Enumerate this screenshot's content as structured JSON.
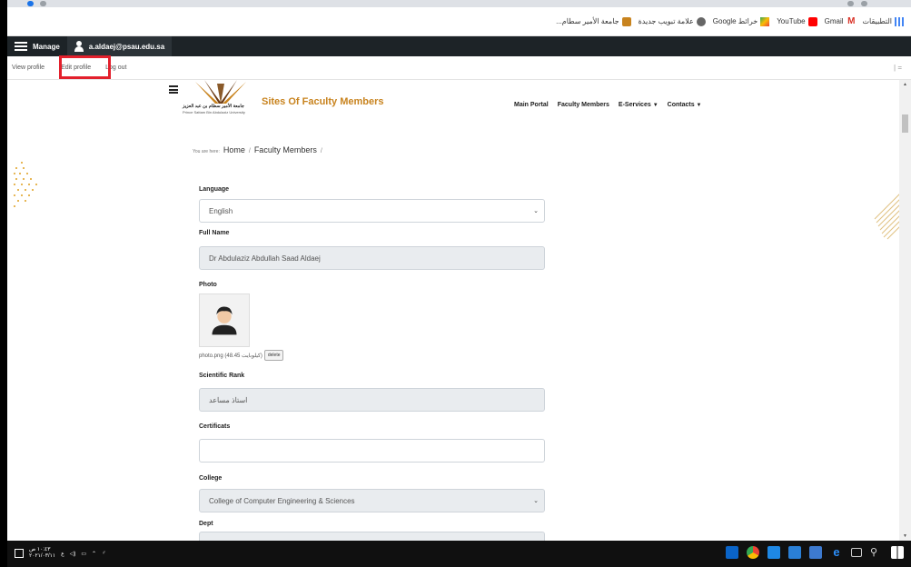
{
  "bookmarks": {
    "apps_label": "التطبيقات",
    "items": [
      "Gmail",
      "YouTube",
      "خرائط Google",
      "علامة تبويب جديدة",
      "جامعة الأمير سطام..."
    ]
  },
  "adminbar": {
    "manage_label": "Manage",
    "user_email": "a.aldaej@psau.edu.sa"
  },
  "submenu": {
    "view_profile": "View profile",
    "edit_profile": "Edit profile",
    "log_out": "Log out",
    "right_mark": "| ="
  },
  "site": {
    "logo_arabic": "جامعة الأمير سطام بن عبد العزيز",
    "logo_english": "Prince Sattam Bin Abdulaziz University",
    "title": "Sites Of Faculty Members",
    "nav": {
      "main_portal": "Main Portal",
      "faculty_members": "Faculty Members",
      "e_services": "E-Services",
      "contacts": "Contacts"
    }
  },
  "breadcrumb": {
    "prefix": "You are here:",
    "home": "Home",
    "faculty_members": "Faculty Members",
    "sep": "/"
  },
  "form": {
    "language_label": "Language",
    "language_value": "English",
    "fullname_label": "Full Name",
    "fullname_value": "Dr Abdulaziz Abdullah Saad Aldaej",
    "photo_label": "Photo",
    "photo_file": "photo.png (48.45 كيلوبايت)",
    "delete_label": "delete",
    "rank_label": "Scientific Rank",
    "rank_value": "استاذ مساعد",
    "certificats_label": "Certificats",
    "certificats_value": "",
    "college_label": "College",
    "college_value": "College of Computer Engineering & Sciences",
    "dept_label": "Dept"
  },
  "taskbar": {
    "time": "١٠:٤٣ ص",
    "date": "٢٠٢١/٠٣/١١",
    "lang": "ع"
  },
  "colors": {
    "accent_gold": "#c8831e",
    "highlight_red": "#e3202c",
    "adminbar_bg": "#1d2327"
  }
}
